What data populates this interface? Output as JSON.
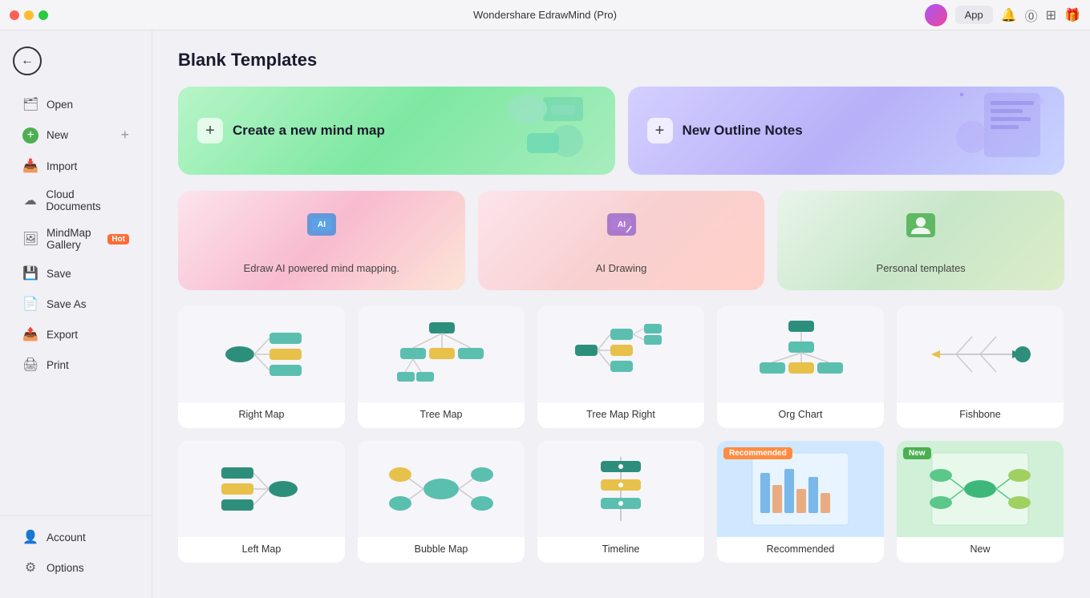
{
  "app": {
    "title": "Wondershare EdrawMind (Pro)"
  },
  "sidebar": {
    "back_label": "←",
    "items": [
      {
        "id": "open",
        "label": "Open",
        "icon": "🗂"
      },
      {
        "id": "new",
        "label": "New",
        "icon": "+",
        "extra": "+"
      },
      {
        "id": "import",
        "label": "Import",
        "icon": "📥"
      },
      {
        "id": "cloud",
        "label": "Cloud Documents",
        "icon": "☁"
      },
      {
        "id": "gallery",
        "label": "MindMap Gallery",
        "icon": "🖼",
        "badge": "Hot"
      },
      {
        "id": "save",
        "label": "Save",
        "icon": "💾"
      },
      {
        "id": "saveas",
        "label": "Save As",
        "icon": "📄"
      },
      {
        "id": "export",
        "label": "Export",
        "icon": "📤"
      },
      {
        "id": "print",
        "label": "Print",
        "icon": "🖨"
      }
    ],
    "bottom_items": [
      {
        "id": "account",
        "label": "Account",
        "icon": "👤"
      },
      {
        "id": "options",
        "label": "Options",
        "icon": "⚙"
      }
    ]
  },
  "topbar": {
    "app_button": "App"
  },
  "main": {
    "title": "Blank Templates",
    "hero_cards": [
      {
        "id": "new-mind-map",
        "label": "Create a new mind map",
        "variant": "green"
      },
      {
        "id": "new-outline",
        "label": "New Outline Notes",
        "variant": "purple"
      }
    ],
    "feature_cards": [
      {
        "id": "ai-mind",
        "label": "Edraw AI powered mind mapping.",
        "variant": "ai"
      },
      {
        "id": "ai-draw",
        "label": "AI Drawing",
        "variant": "ai-draw"
      },
      {
        "id": "personal",
        "label": "Personal templates",
        "variant": "personal"
      }
    ],
    "template_cards": [
      {
        "id": "right-map",
        "label": "Right Map",
        "type": "right-map"
      },
      {
        "id": "tree-map",
        "label": "Tree Map",
        "type": "tree-map"
      },
      {
        "id": "tree-map-right",
        "label": "Tree Map Right",
        "type": "tree-map-right"
      },
      {
        "id": "org-chart",
        "label": "Org Chart",
        "type": "org-chart"
      },
      {
        "id": "fishbone",
        "label": "Fishbone",
        "type": "fishbone"
      }
    ],
    "template_cards_row2": [
      {
        "id": "left-map",
        "label": "Left Map",
        "type": "left-map"
      },
      {
        "id": "bubble",
        "label": "Bubble Map",
        "type": "bubble"
      },
      {
        "id": "timeline",
        "label": "Timeline",
        "type": "timeline"
      },
      {
        "id": "recommended",
        "label": "Recommended",
        "type": "screenshot",
        "badge": "Recommended"
      },
      {
        "id": "new-tpl",
        "label": "New",
        "type": "screenshot-green",
        "badge": "New"
      }
    ]
  }
}
